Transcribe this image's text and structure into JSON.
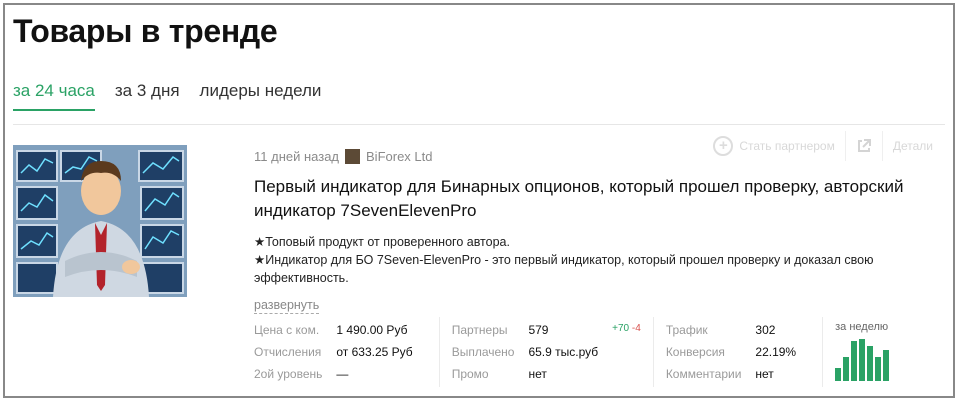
{
  "page": {
    "title": "Товары в тренде",
    "tabs": [
      {
        "label": "за 24 часа",
        "active": true
      },
      {
        "label": "за 3 дня",
        "active": false
      },
      {
        "label": "лидеры недели",
        "active": false
      }
    ]
  },
  "actions": {
    "become_partner": "Стать партнером",
    "details": "Детали",
    "plus_icon": "plus-circle-icon",
    "share_icon": "external-link-icon"
  },
  "product": {
    "time_ago": "11 дней назад",
    "vendor": "BiForex Ltd",
    "title": "Первый индикатор для Бинарных опционов, который прошел проверку, авторский индикатор 7SevenElevenPro",
    "description_1": "★Топовый продукт от проверенного автора.",
    "description_2": "★Индикатор для БО 7Seven-ElevenPro - это первый индикатор, который прошел проверку и доказал свою эффективность.",
    "expand_label": "развернуть",
    "image_alt": "product-image"
  },
  "stats": {
    "price_label": "Цена с ком.",
    "price_value": "1 490.00 Руб",
    "deductions_label": "Отчисления",
    "deductions_value": "от 633.25 Руб",
    "second_level_label": "2ой уровень",
    "second_level_value": "—",
    "partners_label": "Партнеры",
    "partners_value": "579",
    "partners_up": "+70",
    "partners_down": "-4",
    "paid_label": "Выплачено",
    "paid_value": "65.9 тыс.руб",
    "promo_label": "Промо",
    "promo_value": "нет",
    "traffic_label": "Трафик",
    "traffic_value": "302",
    "conversion_label": "Конверсия",
    "conversion_value": "22.19%",
    "comments_label": "Комментарии",
    "comments_value": "нет",
    "week_label": "за неделю",
    "week_bars": [
      0.3,
      0.55,
      0.9,
      0.95,
      0.8,
      0.55,
      0.7
    ],
    "accent_color": "#2aa265"
  }
}
